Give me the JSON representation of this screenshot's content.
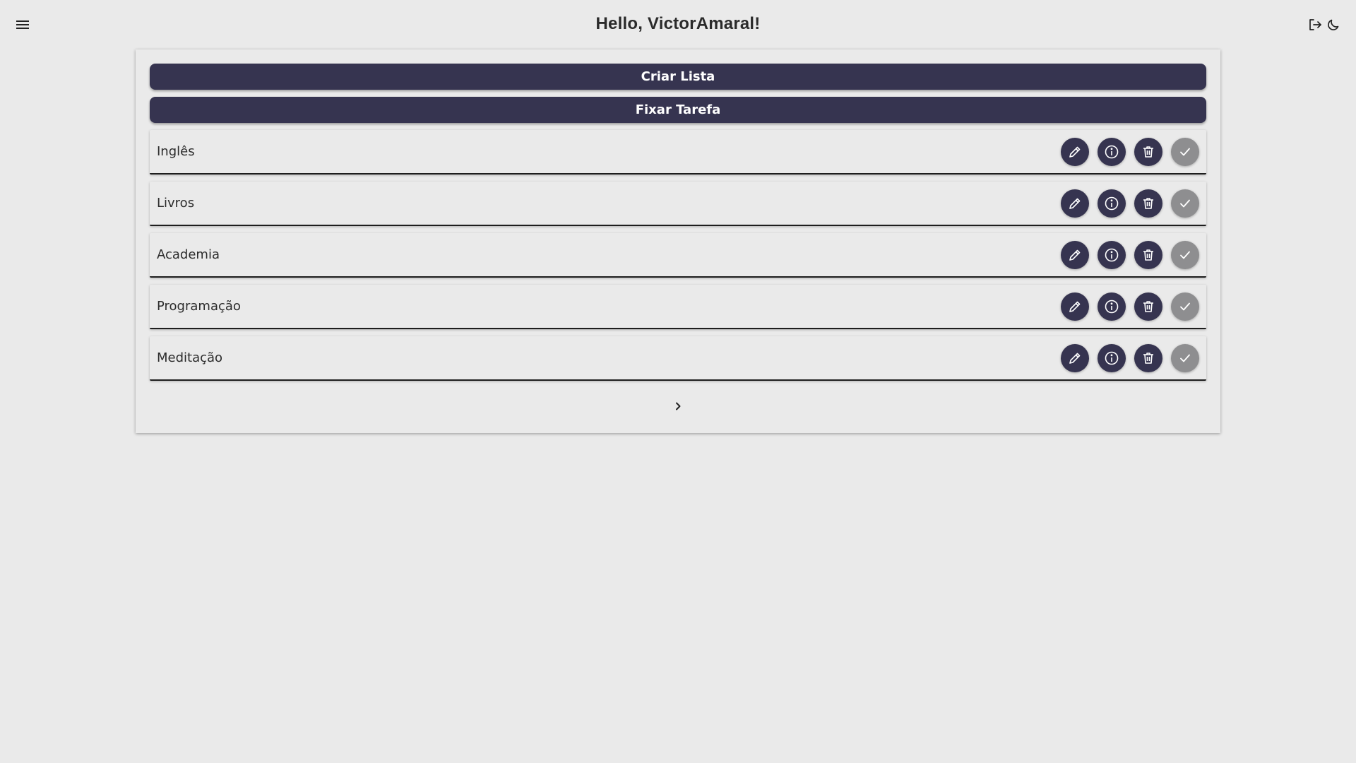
{
  "header": {
    "title": "Hello, VictorAmaral!",
    "menu_icon": "menu-icon",
    "logout_icon": "logout-icon",
    "theme_icon": "moon-icon"
  },
  "actions": {
    "create_list": "Criar Lista",
    "pin_task": "Fixar Tarefa"
  },
  "lists": [
    {
      "label": "Inglês"
    },
    {
      "label": "Livros"
    },
    {
      "label": "Academia"
    },
    {
      "label": "Programação"
    },
    {
      "label": "Meditação"
    }
  ],
  "item_actions": [
    "pencil-icon",
    "info-icon",
    "trash-icon",
    "check-icon"
  ],
  "pagination": {
    "next_icon": "chevron-right-icon"
  },
  "colors": {
    "background": "#eaeaea",
    "primary": "#363450",
    "done": "#8e8e90",
    "text": "#2b2b2b"
  }
}
